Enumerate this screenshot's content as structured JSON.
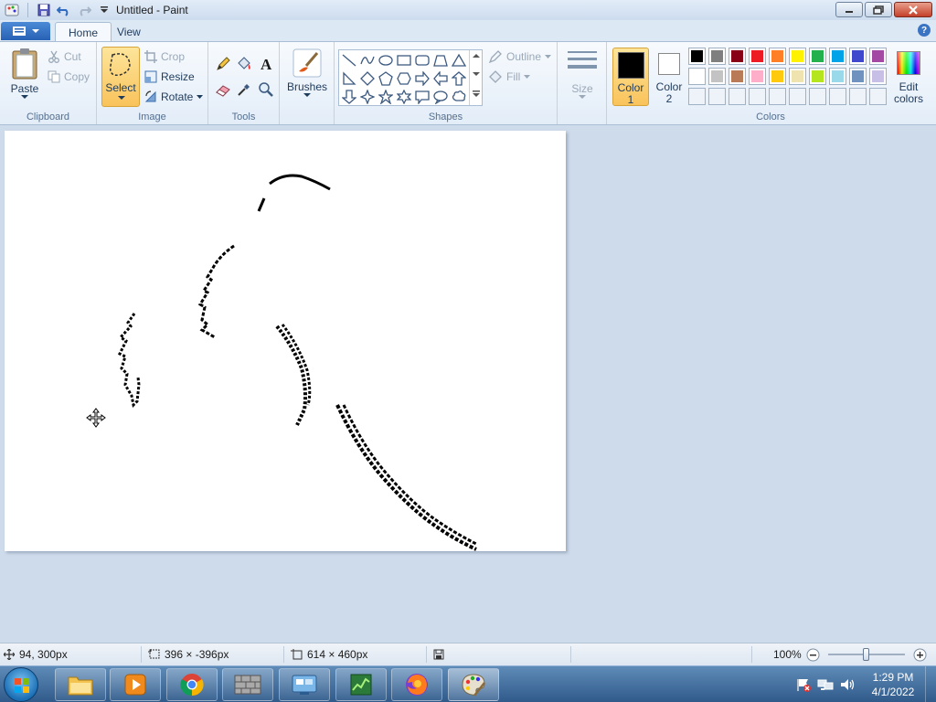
{
  "window": {
    "title": "Untitled - Paint"
  },
  "tabs": [
    {
      "label": "Home",
      "active": true
    },
    {
      "label": "View",
      "active": false
    }
  ],
  "ribbon": {
    "clipboard": {
      "paste": "Paste",
      "cut": "Cut",
      "copy": "Copy",
      "label": "Clipboard"
    },
    "image": {
      "select": "Select",
      "crop": "Crop",
      "resize": "Resize",
      "rotate": "Rotate",
      "label": "Image"
    },
    "tools": {
      "label": "Tools"
    },
    "brushes": {
      "label": "Brushes"
    },
    "shapes": {
      "outline": "Outline",
      "fill": "Fill",
      "label": "Shapes"
    },
    "size": {
      "label": "Size"
    },
    "colors": {
      "color1": "Color\n1",
      "color1_line1": "Color",
      "color1_line2": "1",
      "color2_line1": "Color",
      "color2_line2": "2",
      "edit_line1": "Edit",
      "edit_line2": "colors",
      "label": "Colors",
      "color1_value": "#000000",
      "color2_value": "#ffffff",
      "palette_row1": [
        "#000000",
        "#7f7f7f",
        "#880015",
        "#ed1c24",
        "#ff7f27",
        "#fff200",
        "#22b14c",
        "#00a2e8",
        "#3f48cc",
        "#a349a4"
      ],
      "palette_row2": [
        "#ffffff",
        "#c3c3c3",
        "#b97a57",
        "#ffaec9",
        "#ffc90e",
        "#efe4b0",
        "#b5e61d",
        "#99d9ea",
        "#7092be",
        "#c8bfe7"
      ],
      "palette_row3_count": 10
    }
  },
  "status": {
    "cursor_pos": "94, 300px",
    "selection_size": "396 × -396px",
    "canvas_size": "614 × 460px",
    "zoom": "100%"
  },
  "taskbar": {
    "time": "1:29 PM",
    "date": "4/1/2022"
  }
}
